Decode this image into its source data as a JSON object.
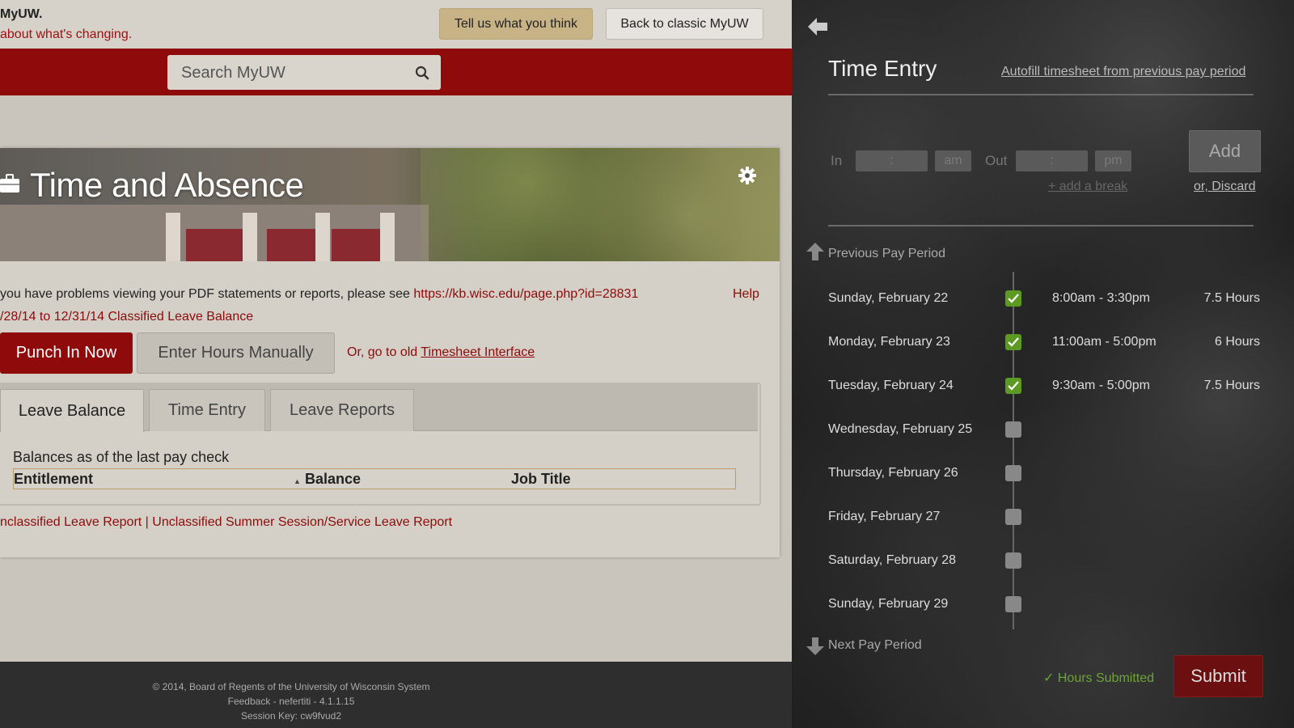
{
  "topbar": {
    "brand": "MyUW.",
    "about": " about what's changing.",
    "feedback_label": "Tell us what you think",
    "classic_label": "Back to classic MyUW"
  },
  "search": {
    "placeholder": "Search MyUW"
  },
  "card": {
    "title": "Time and Absence",
    "pdf_note": "you have problems viewing your PDF statements or reports, please see ",
    "pdf_link": "https://kb.wisc.edu/page.php?id=28831",
    "help": "Help",
    "leave_balance_link": "/28/14 to 12/31/14 Classified Leave Balance",
    "punch_label": "Punch In Now",
    "manual_label": "Enter Hours Manually",
    "old_prefix": "Or, go to old ",
    "old_link": "Timesheet Interface",
    "tabs": [
      {
        "label": "Leave Balance"
      },
      {
        "label": "Time Entry"
      },
      {
        "label": "Leave Reports"
      }
    ],
    "balance_note": "Balances as of the last pay check",
    "columns": [
      "Entitlement",
      "Balance",
      "Job Title"
    ],
    "reports_links": "nclassified Leave Report | Unclassified Summer Session/Service Leave Report"
  },
  "footer": {
    "copyright": "© 2014, Board of Regents of the University of Wisconsin System",
    "feedback": "Feedback - nefertiti - 4.1.1.15",
    "session": "Session Key: cw9fvud2"
  },
  "panel": {
    "title": "Time Entry",
    "autofill": "Autofill timesheet from previous pay period",
    "in_label": "In",
    "in_time": " : ",
    "in_ampm": "am",
    "out_label": "Out",
    "out_time": " : ",
    "out_ampm": "pm",
    "add_label": "Add",
    "add_break": "+ add a break",
    "discard": "or, Discard",
    "prev_period": "Previous Pay Period",
    "next_period": "Next Pay Period",
    "days": [
      {
        "day": "Sunday, February 22",
        "checked": true,
        "times": "8:00am - 3:30pm",
        "hours": "7.5 Hours"
      },
      {
        "day": "Monday, February 23",
        "checked": true,
        "times": "11:00am - 5:00pm",
        "hours": "6 Hours"
      },
      {
        "day": "Tuesday, February 24",
        "checked": true,
        "times": "9:30am - 5:00pm",
        "hours": "7.5 Hours"
      },
      {
        "day": "Wednesday, February 25",
        "checked": false,
        "times": "",
        "hours": ""
      },
      {
        "day": "Thursday, February 26",
        "checked": false,
        "times": "",
        "hours": ""
      },
      {
        "day": "Friday, February 27",
        "checked": false,
        "times": "",
        "hours": ""
      },
      {
        "day": "Saturday, February 28",
        "checked": false,
        "times": "",
        "hours": ""
      },
      {
        "day": "Sunday, February 29",
        "checked": false,
        "times": "",
        "hours": ""
      }
    ],
    "submitted": "Hours Submitted",
    "submit_label": "Submit"
  },
  "colors": {
    "accent_red": "#8f0a0a",
    "check_green": "#5d9a23",
    "submit_red": "#6b0f10"
  }
}
